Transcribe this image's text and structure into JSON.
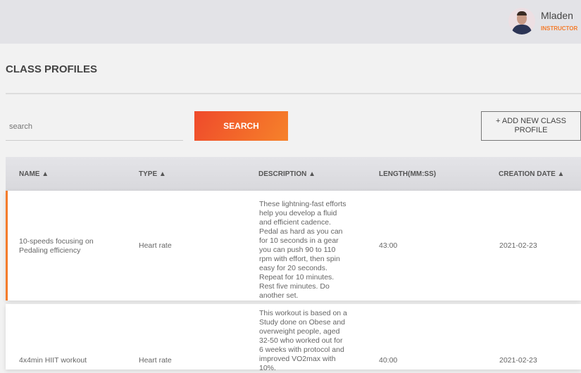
{
  "user": {
    "name": "Mladen",
    "role": "INSTRUCTOR"
  },
  "page": {
    "title": "CLASS PROFILES"
  },
  "search": {
    "placeholder": "search",
    "button": "SEARCH"
  },
  "add_button": "+ ADD NEW CLASS PROFILE",
  "table": {
    "headers": [
      "NAME ▲",
      "TYPE ▲",
      "DESCRIPTION ▲",
      "LENGTH(MM:SS)",
      "CREATION DATE ▲"
    ],
    "rows": [
      {
        "name": "10-speeds focusing on Pedaling efficiency",
        "type": "Heart rate",
        "description": "These lightning-fast efforts help you develop a fluid and efficient cadence. Pedal as hard as you can for 10 seconds in a gear you can push 90 to 110 rpm with effort, then spin easy for 20 seconds. Repeat for 10 minutes. Rest five minutes. Do another set.",
        "length": "43:00",
        "date": "2021-02-23"
      },
      {
        "name": "4x4min HIIT workout",
        "type": "Heart rate",
        "description": "This workout is based on a Study done on Obese and overweight people, aged 32-50 who worked out for 6 weeks with protocol and improved VO2max with 10%.",
        "length": "40:00",
        "date": "2021-02-23"
      }
    ]
  }
}
